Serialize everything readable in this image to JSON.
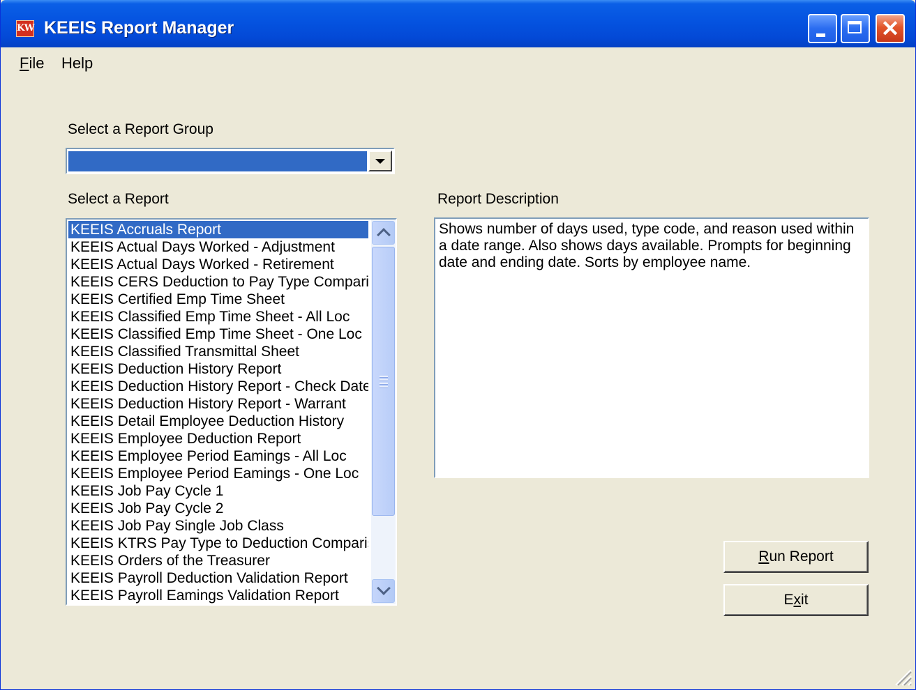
{
  "window": {
    "title": "KEEIS Report Manager",
    "icon_label": "KW"
  },
  "title_buttons": {
    "minimize": "minimize-icon",
    "maximize": "maximize-icon",
    "close": "close-icon"
  },
  "menu": {
    "file": {
      "accel": "F",
      "rest": "ile"
    },
    "help": "Help"
  },
  "report_group": {
    "label": "Select a Report Group",
    "value": ""
  },
  "report_list": {
    "label": "Select a Report",
    "selected_index": 0,
    "items": [
      "KEEIS Accruals Report",
      "KEEIS Actual Days Worked - Adjustment",
      "KEEIS Actual Days Worked - Retirement",
      "KEEIS CERS Deduction to Pay Type Comparisc",
      "KEEIS Certified Emp Time Sheet",
      "KEEIS Classified Emp Time Sheet - All Loc",
      "KEEIS Classified Emp Time Sheet - One Loc",
      "KEEIS Classified Transmittal Sheet",
      "KEEIS Deduction History Report",
      "KEEIS Deduction History Report - Check Date",
      "KEEIS Deduction History Report - Warrant",
      "KEEIS Detail Employee Deduction History",
      "KEEIS Employee Deduction Report",
      "KEEIS Employee Period Eamings - All Loc",
      "KEEIS Employee Period Eamings - One Loc",
      "KEEIS Job Pay Cycle 1",
      "KEEIS Job Pay Cycle 2",
      "KEEIS Job Pay Single Job Class",
      "KEEIS KTRS Pay Type to Deduction Comparisc",
      "KEEIS Orders of the Treasurer",
      "KEEIS Payroll Deduction Validation Report",
      "KEEIS Payroll Eamings Validation Report"
    ]
  },
  "description": {
    "label": "Report Description",
    "text": "Shows number of days used, type code, and reason used within a date range.  Also shows days available.  Prompts for beginning date and ending date.  Sorts by employee name."
  },
  "buttons": {
    "run": {
      "accel": "R",
      "rest": "un Report"
    },
    "exit": {
      "pre": "E",
      "accel": "x",
      "rest": "it"
    }
  },
  "colors": {
    "selection": "#316ac5",
    "face": "#ece9d8",
    "titlebar": "#0553e0",
    "close": "#e2552a"
  }
}
